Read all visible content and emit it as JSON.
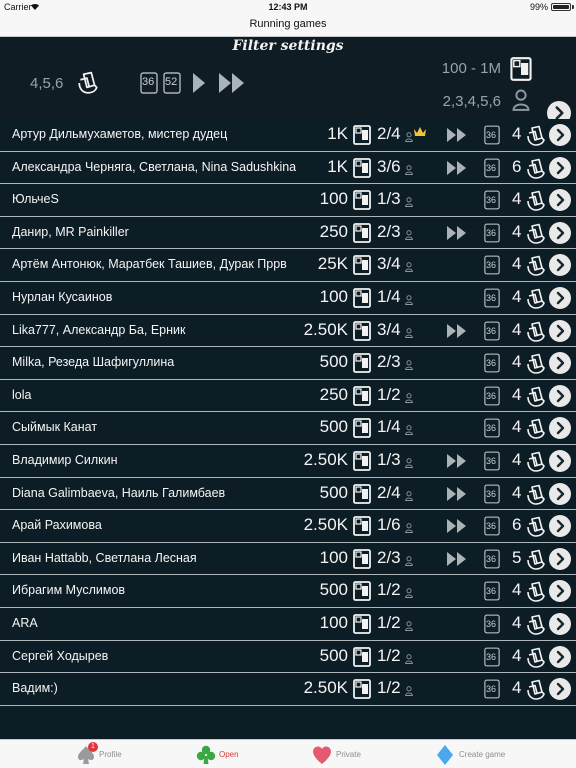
{
  "status": {
    "carrier": "Carrier",
    "time": "12:43 PM",
    "battery": "99%",
    "battery_level": 0.99
  },
  "nav": {
    "title": "Running games"
  },
  "filter": {
    "title": "Filter settings",
    "players": "4,5,6",
    "deck_a": "36",
    "deck_b": "52",
    "bet_range": "100 - 1M",
    "player_counts": "2,3,4,5,6"
  },
  "games": [
    {
      "name": "Артур Дильмухаметов, мистер дудец",
      "bet": "1K",
      "players": "2/4",
      "crown": true,
      "fast": true,
      "deck": "36",
      "cards": "4"
    },
    {
      "name": "Александра Черняга, Светлана, Nina Sadushkina",
      "bet": "1K",
      "players": "3/6",
      "crown": false,
      "fast": true,
      "deck": "36",
      "cards": "6"
    },
    {
      "name": "ЮльчеS",
      "bet": "100",
      "players": "1/3",
      "crown": false,
      "fast": false,
      "deck": "36",
      "cards": "4"
    },
    {
      "name": "Данир, MR Painkiller",
      "bet": "250",
      "players": "2/3",
      "crown": false,
      "fast": true,
      "deck": "36",
      "cards": "4"
    },
    {
      "name": "Артём Антонюк, Маратбек Ташиев, Дурак Пррв",
      "bet": "25K",
      "players": "3/4",
      "crown": false,
      "fast": false,
      "deck": "36",
      "cards": "4"
    },
    {
      "name": "Нурлан Кусаинов",
      "bet": "100",
      "players": "1/4",
      "crown": false,
      "fast": false,
      "deck": "36",
      "cards": "4"
    },
    {
      "name": "Lika777, Александр Ба, Ерник",
      "bet": "2.50K",
      "players": "3/4",
      "crown": false,
      "fast": true,
      "deck": "36",
      "cards": "4"
    },
    {
      "name": "Milka, Резеда Шафигуллина",
      "bet": "500",
      "players": "2/3",
      "crown": false,
      "fast": false,
      "deck": "36",
      "cards": "4"
    },
    {
      "name": "lola",
      "bet": "250",
      "players": "1/2",
      "crown": false,
      "fast": false,
      "deck": "36",
      "cards": "4"
    },
    {
      "name": "Сыймык Канат",
      "bet": "500",
      "players": "1/4",
      "crown": false,
      "fast": false,
      "deck": "36",
      "cards": "4"
    },
    {
      "name": "Владимир Силкин",
      "bet": "2.50K",
      "players": "1/3",
      "crown": false,
      "fast": true,
      "deck": "36",
      "cards": "4"
    },
    {
      "name": "Diana Galimbaeva, Наиль Галимбаев",
      "bet": "500",
      "players": "2/4",
      "crown": false,
      "fast": true,
      "deck": "36",
      "cards": "4"
    },
    {
      "name": "Арай Рахимова",
      "bet": "2.50K",
      "players": "1/6",
      "crown": false,
      "fast": true,
      "deck": "36",
      "cards": "6"
    },
    {
      "name": "Иван Hattabb, Светлана Лесная",
      "bet": "100",
      "players": "2/3",
      "crown": false,
      "fast": true,
      "deck": "36",
      "cards": "5"
    },
    {
      "name": "Ибрагим Муслимов",
      "bet": "500",
      "players": "1/2",
      "crown": false,
      "fast": false,
      "deck": "36",
      "cards": "4"
    },
    {
      "name": "ARA",
      "bet": "100",
      "players": "1/2",
      "crown": false,
      "fast": false,
      "deck": "36",
      "cards": "4"
    },
    {
      "name": "Сергей Ходырев",
      "bet": "500",
      "players": "1/2",
      "crown": false,
      "fast": false,
      "deck": "36",
      "cards": "4"
    },
    {
      "name": "Вадим:)",
      "bet": "2.50K",
      "players": "1/2",
      "crown": false,
      "fast": false,
      "deck": "36",
      "cards": "4"
    }
  ],
  "tabs": {
    "profile": {
      "label": "Profile",
      "badge": "1",
      "icon": "spade-icon"
    },
    "open": {
      "label": "Open",
      "icon": "club-icon"
    },
    "private": {
      "label": "Private",
      "icon": "heart-icon"
    },
    "create": {
      "label": "Create game",
      "icon": "diamond-icon"
    }
  },
  "colors": {
    "accent": "#e0363b",
    "background": "#0d1d26",
    "diamond": "#4aa8ef"
  }
}
